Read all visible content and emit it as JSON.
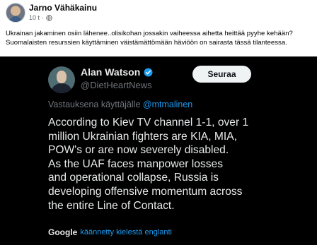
{
  "post": {
    "author": "Jarno Vähäkainu",
    "time": "10 t",
    "privacy_separator": "·",
    "more_label": "···",
    "text_lines": [
      "Ukrainan jakaminen osiin lähenee..olisikohan jossakin vaiheessa aihetta heittää pyyhe kehään?",
      "Suomalaisten resurssien käyttäminen väistämättömään häviöön on sairasta tässä tilanteessa."
    ]
  },
  "tweet": {
    "name": "Alan Watson",
    "handle": "@DietHeartNews",
    "follow_label": "Seuraa",
    "reply_prefix": "Vastauksena käyttäjälle ",
    "reply_mention": "@mtmalinen",
    "body_lines": [
      "According to Kiev TV channel 1-1, over 1",
      "million Ukrainian fighters are KIA, MIA,",
      "POW's or are now severely disabled.",
      "As the UAF faces manpower losses",
      "and operational collapse, Russia is",
      "developing offensive momentum across",
      "the entire Line of Contact."
    ],
    "translate_brand": "Google",
    "translate_label": "käännetty kielestä englanti"
  },
  "colors": {
    "accent_blue": "#1d9bf0",
    "tweet_bg": "#000000",
    "muted_text": "#71767b"
  },
  "icons": [
    "globe-icon",
    "verified-icon",
    "more-icon"
  ]
}
